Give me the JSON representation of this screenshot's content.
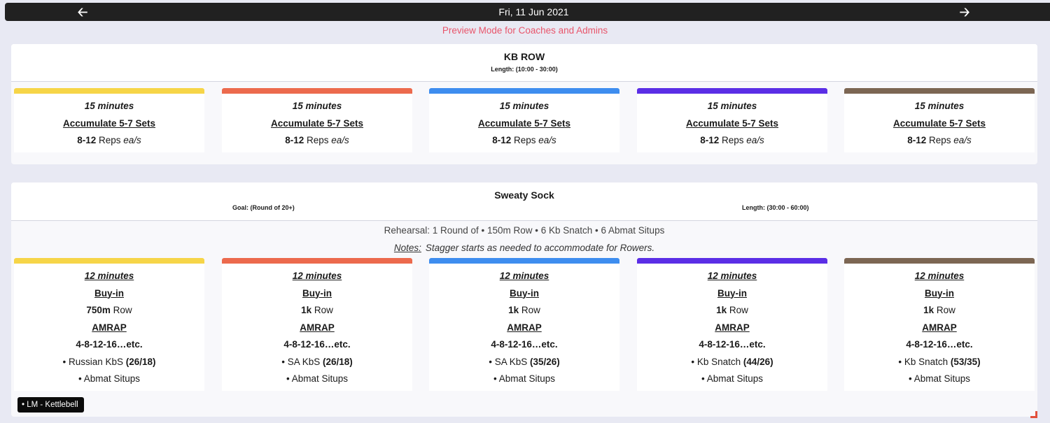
{
  "nav": {
    "date": "Fri, 11 Jun 2021",
    "prev_icon": "arrow-left-icon",
    "next_icon": "arrow-right-icon"
  },
  "preview_text": "Preview Mode for Coaches and Admins",
  "colors": {
    "yellow": "#f6d548",
    "orange": "#ec6a4d",
    "blue": "#3e8def",
    "purple": "#5b2ee6",
    "brown": "#7c6653"
  },
  "workout1": {
    "title": "KB ROW",
    "length": "Length: (10:00 - 30:00)",
    "cards": [
      {
        "time": "15 minutes",
        "sets": "Accumulate 5-7 Sets",
        "reps_num": "8-12",
        "reps_word": " Reps ",
        "reps_unit": "ea/s"
      },
      {
        "time": "15 minutes",
        "sets": "Accumulate 5-7 Sets",
        "reps_num": "8-12",
        "reps_word": " Reps ",
        "reps_unit": "ea/s"
      },
      {
        "time": "15 minutes",
        "sets": "Accumulate 5-7 Sets",
        "reps_num": "8-12",
        "reps_word": " Reps ",
        "reps_unit": "ea/s"
      },
      {
        "time": "15 minutes",
        "sets": "Accumulate 5-7 Sets",
        "reps_num": "8-12",
        "reps_word": " Reps ",
        "reps_unit": "ea/s"
      },
      {
        "time": "15 minutes",
        "sets": "Accumulate 5-7 Sets",
        "reps_num": "8-12",
        "reps_word": " Reps ",
        "reps_unit": "ea/s"
      }
    ]
  },
  "workout2": {
    "title": "Sweaty Sock",
    "goal": "Goal: (Round of 20+)",
    "length": "Length: (30:00 - 60:00)",
    "rehearsal": "Rehearsal: 1 Round of • 150m Row • 6 Kb Snatch • 6 Abmat Situps",
    "notes_label": "Notes:",
    "notes_text": "Stagger starts as needed to accommodate for Rowers.",
    "cards": [
      {
        "time": "12 minutes",
        "buyin": "Buy-in",
        "row_dist": "750m",
        "row_word": " Row",
        "amrap": "AMRAP",
        "scheme": "4-8-12-16…etc.",
        "kb_name": "• Russian KbS ",
        "kb_weight": "(26/18)",
        "situps": "• Abmat Situps"
      },
      {
        "time": "12 minutes",
        "buyin": "Buy-in",
        "row_dist": "1k",
        "row_word": " Row",
        "amrap": "AMRAP",
        "scheme": "4-8-12-16…etc.",
        "kb_name": "• SA KbS ",
        "kb_weight": "(26/18)",
        "situps": "• Abmat Situps"
      },
      {
        "time": "12 minutes",
        "buyin": "Buy-in",
        "row_dist": "1k",
        "row_word": " Row",
        "amrap": "AMRAP",
        "scheme": "4-8-12-16…etc.",
        "kb_name": "• SA KbS ",
        "kb_weight": "(35/26)",
        "situps": "• Abmat Situps"
      },
      {
        "time": "12 minutes",
        "buyin": "Buy-in",
        "row_dist": "1k",
        "row_word": " Row",
        "amrap": "AMRAP",
        "scheme": "4-8-12-16…etc.",
        "kb_name": "• Kb Snatch ",
        "kb_weight": "(44/26)",
        "situps": "• Abmat Situps"
      },
      {
        "time": "12 minutes",
        "buyin": "Buy-in",
        "row_dist": "1k",
        "row_word": " Row",
        "amrap": "AMRAP",
        "scheme": "4-8-12-16…etc.",
        "kb_name": "• Kb Snatch ",
        "kb_weight": "(53/35)",
        "situps": "• Abmat Situps"
      }
    ]
  },
  "tag": "• LM - Kettlebell"
}
